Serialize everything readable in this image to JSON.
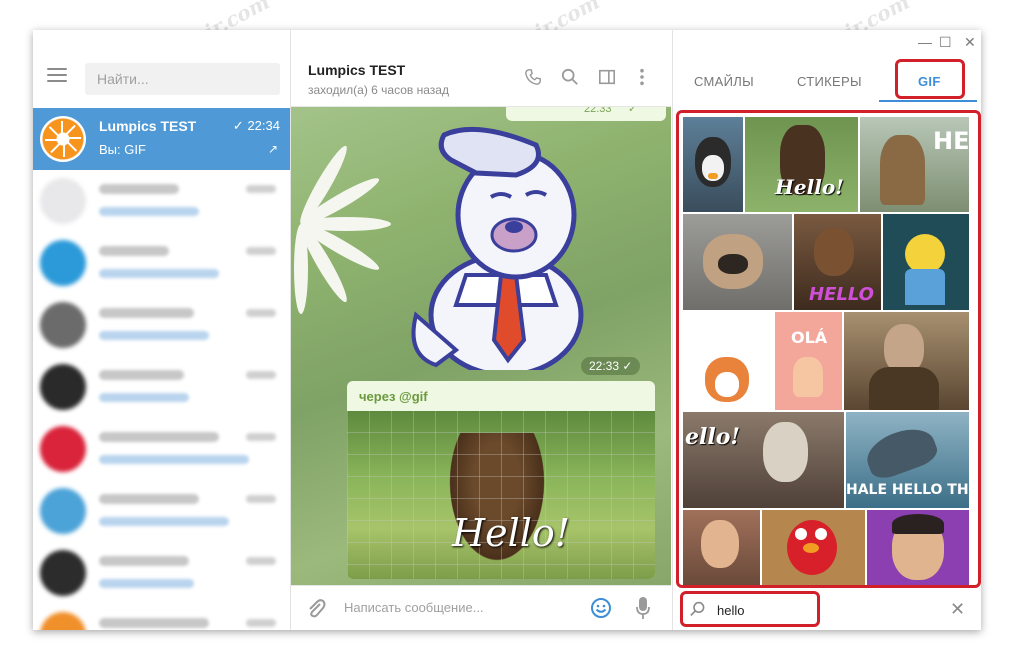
{
  "left_panel": {
    "search_placeholder": "Найти...",
    "active_chat": {
      "name": "Lumpics TEST",
      "time": "22:34",
      "last_message": "Вы: GIF",
      "check": "✓",
      "pin": "📌"
    },
    "blurred_rows": [
      {
        "avatar_color": "#e8e8ea"
      },
      {
        "avatar_color": "#2c9ad9"
      },
      {
        "avatar_color": "#6b6b6b"
      },
      {
        "avatar_color": "#2a2a2a"
      },
      {
        "avatar_color": "#d9243b"
      },
      {
        "avatar_color": "#4ca3d8"
      },
      {
        "avatar_color": "#2c2c2c"
      },
      {
        "avatar_color": "#f0902b"
      }
    ]
  },
  "chat": {
    "title": "Lumpics TEST",
    "subtitle": "заходил(а) 6 часов назад",
    "top_time": "22:33",
    "sticker_time": "22:33",
    "gif_via": "через @gif",
    "gif_caption": "Hello!",
    "input_placeholder": "Написать сообщение..."
  },
  "emoji_panel": {
    "tabs": [
      {
        "label": "СМАЙЛЫ"
      },
      {
        "label": "СТИКЕРЫ"
      },
      {
        "label": "GIF"
      }
    ],
    "active_tab": "GIF",
    "search_value": "hello",
    "window_controls": {
      "minimize": "—",
      "maximize": "☐",
      "close": "✕"
    },
    "tiles": {
      "t2": "Hello!",
      "t3": "HEY",
      "t5": "HELLO",
      "t8": "OLÁ",
      "t10": "ello!",
      "t12": "HALE HELLO THE"
    }
  },
  "watermark": "Soringpcrepair.com",
  "colors": {
    "accent": "#3d8ed6",
    "active_chat_bg": "#4f9ad6",
    "highlight_red": "#d2202a"
  }
}
